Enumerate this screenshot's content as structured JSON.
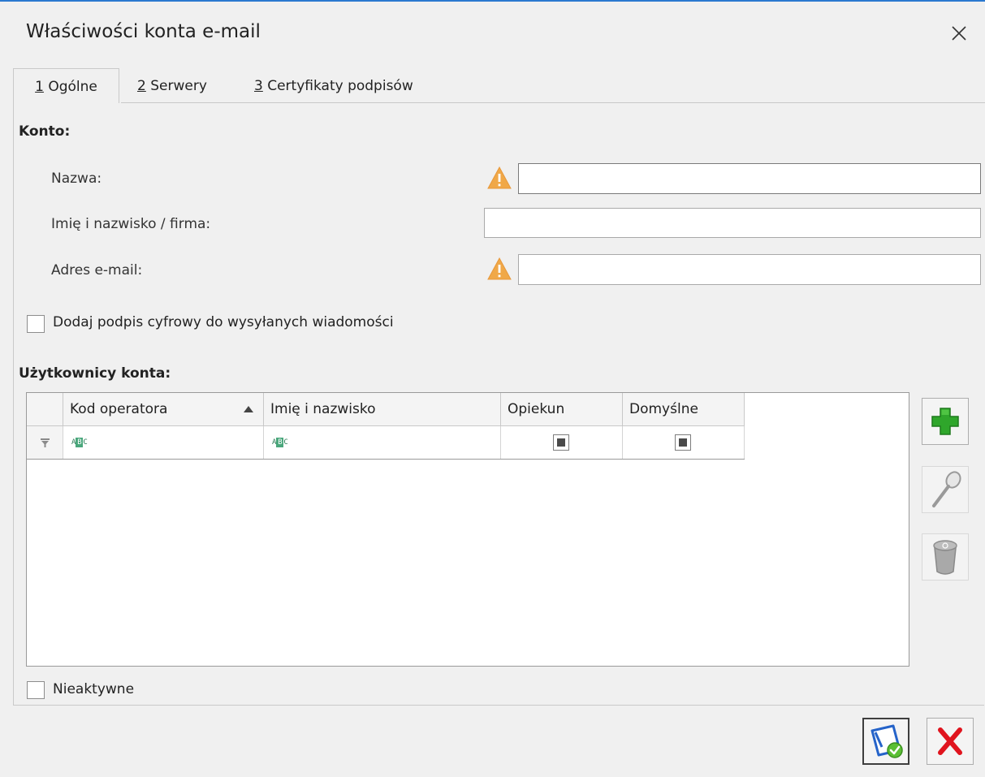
{
  "window": {
    "title": "Właściwości konta e-mail"
  },
  "tabs": [
    {
      "key": "1",
      "rest": " Ogólne"
    },
    {
      "key": "2",
      "rest": " Serwery"
    },
    {
      "key": "3",
      "rest": " Certyfikaty podpisów"
    }
  ],
  "account": {
    "section_title": "Konto:",
    "name_label": "Nazwa:",
    "name_value": "",
    "fullname_label": "Imię i nazwisko / firma:",
    "fullname_value": "",
    "email_label": "Adres e-mail:",
    "email_value": "",
    "signature_checkbox_label": "Dodaj podpis cyfrowy do wysyłanych wiadomości"
  },
  "users": {
    "section_title": "Użytkownicy konta:",
    "columns": [
      "Kod operatora",
      "Imię i nazwisko",
      "Opiekun",
      "Domyślne"
    ],
    "filter_abc": {
      "a": "A",
      "b": "B",
      "c": "C"
    },
    "rows": []
  },
  "inactive_checkbox_label": "Nieaktywne",
  "icons": {
    "close": "close-icon",
    "warning": "warning-icon",
    "add": "add-icon",
    "edit": "magnifier-icon",
    "delete": "trash-icon",
    "save": "save-icon",
    "cancel": "cancel-icon",
    "filter": "filter-icon",
    "sort": "sort-ascending-icon"
  },
  "colors": {
    "accent": "#2b79d0",
    "warning": "#f0a848",
    "add_green": "#2fa62b",
    "cancel_red": "#e0141e"
  }
}
